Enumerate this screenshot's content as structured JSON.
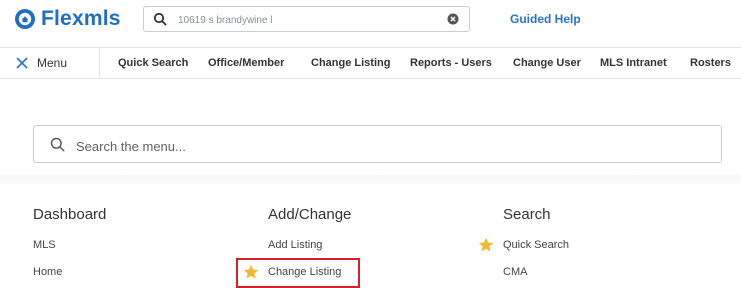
{
  "header": {
    "logo_text": "Flexmls",
    "search_value": "10619 s brandywine l",
    "guided_help": "Guided Help"
  },
  "nav": {
    "menu_label": "Menu",
    "items": [
      "Quick Search",
      "Office/Member",
      "Change Listing",
      "Reports - Users",
      "Change User",
      "MLS Intranet",
      "Rosters"
    ]
  },
  "menu_search": {
    "placeholder": "Search the menu..."
  },
  "columns": [
    {
      "heading": "Dashboard",
      "links": [
        "MLS",
        "Home"
      ]
    },
    {
      "heading": "Add/Change",
      "links": [
        "Add Listing",
        "Change Listing"
      ]
    },
    {
      "heading": "Search",
      "links": [
        "Quick Search",
        "CMA"
      ]
    }
  ],
  "colors": {
    "brand": "#1e6fc2",
    "link": "#2b73c8",
    "star": "#f4b732",
    "highlight": "#d8202a"
  },
  "icons": {
    "logo": "flexmls-logo-icon",
    "search": "search-icon",
    "clear": "clear-icon",
    "close": "close-icon",
    "favorite": "star-icon"
  }
}
